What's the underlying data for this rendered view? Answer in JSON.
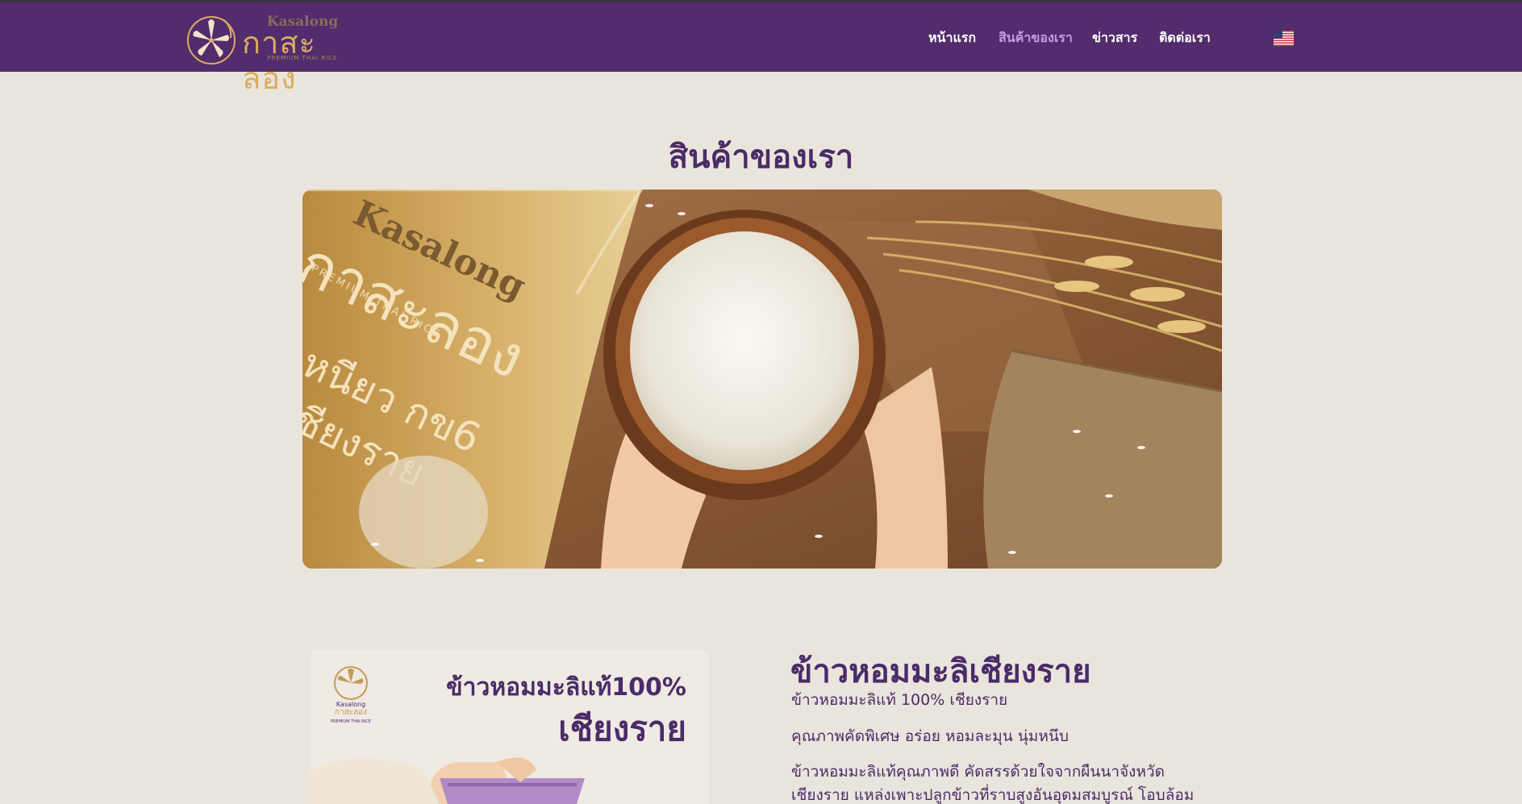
{
  "header": {
    "logo": {
      "english_name": "Kasalong",
      "thai_name": "กาสะลอง",
      "tagline": "PREMIUM THAI RICE"
    },
    "nav": [
      {
        "label": "หน้าแรก",
        "active": false
      },
      {
        "label": "สินค้าของเรา",
        "active": true
      },
      {
        "label": "ข่าวสาร",
        "active": false
      },
      {
        "label": "ติดต่อเรา",
        "active": false
      }
    ],
    "language_icon": "us-flag-icon"
  },
  "main": {
    "page_title": "สินค้าของเรา",
    "hero_image": {
      "bag_brand": "Kasalong",
      "bag_thai_name": "กาสะลอง",
      "bag_tagline": "PREMIUM THAI RICE",
      "bag_variety": "เหนียว กข6",
      "bag_region": "เชียงราย"
    },
    "product": {
      "image": {
        "brand_en": "Kasalong",
        "brand_th": "กาสะลอง",
        "brand_tag": "PREMIUM THAI RICE",
        "headline_line1": "ข้าวหอมมะลิแท้100%",
        "headline_line2": "เชียงราย"
      },
      "title": "ข้าวหอมมะลิเชียงราย",
      "subtitle": "ข้าวหอมมะลิแท้ 100% เชียงราย",
      "tagline": "คุณภาพคัดพิเศษ อร่อย หอมละมุน นุ่มหนึบ",
      "description_line1": "ข้าวหอมมะลิแท้คุณภาพดี คัดสรรด้วยใจจากผืนนาจังหวัด",
      "description_line2": "เชียงราย แหล่งเพาะปลูกข้าวที่ราบสูงอันอุดมสมบูรณ์ โอบล้อม"
    }
  },
  "colors": {
    "header_bg": "#522c6c",
    "page_bg": "#e9e5dc",
    "brand_purple": "#4b2b68",
    "nav_active": "#c69be3",
    "gold": "#d9ac62"
  }
}
